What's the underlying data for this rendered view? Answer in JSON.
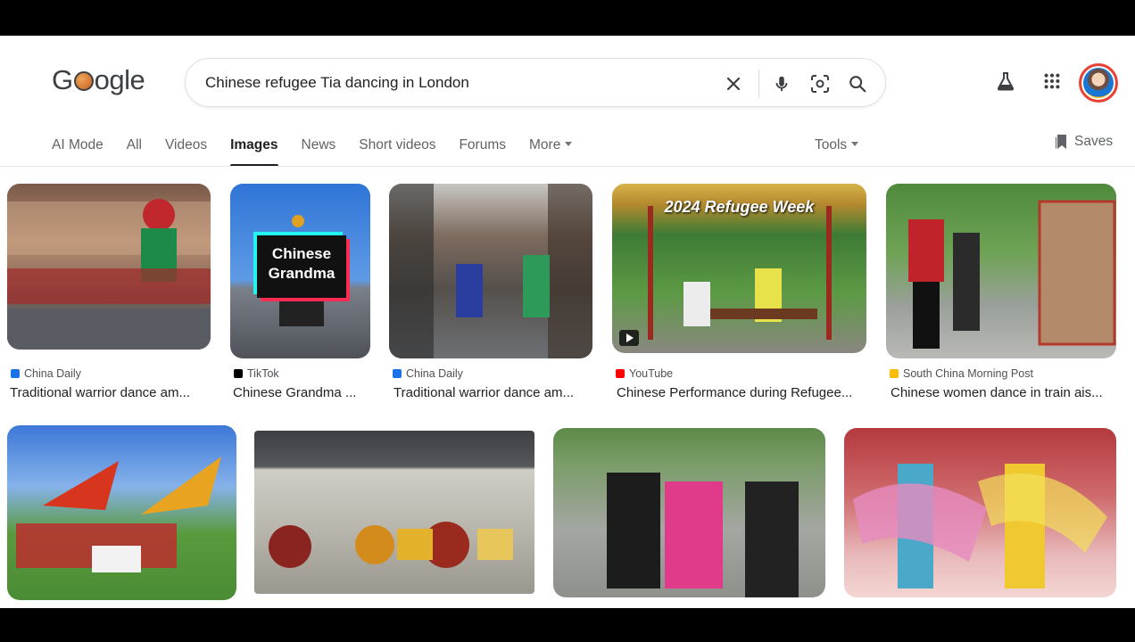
{
  "header": {
    "logo_text": "Google",
    "search_query": "Chinese refugee Tia dancing in London"
  },
  "tabs": [
    {
      "label": "AI Mode"
    },
    {
      "label": "All"
    },
    {
      "label": "Videos"
    },
    {
      "label": "Images",
      "active": true
    },
    {
      "label": "News"
    },
    {
      "label": "Short videos"
    },
    {
      "label": "Forums"
    },
    {
      "label": "More"
    }
  ],
  "tools_label": "Tools",
  "saves_label": "Saves",
  "results_row1": [
    {
      "source": "China Daily",
      "source_color": "#1a73e8",
      "title": "Traditional warrior dance am..."
    },
    {
      "source": "TikTok",
      "source_color": "#000000",
      "title": "Chinese Grandma ...",
      "overlay": "Chinese Grandma"
    },
    {
      "source": "China Daily",
      "source_color": "#1a73e8",
      "title": "Traditional warrior dance am..."
    },
    {
      "source": "YouTube",
      "source_color": "#ff0000",
      "title": "Chinese Performance during Refugee...",
      "overlay": "2024 Refugee Week"
    },
    {
      "source": "South China Morning Post",
      "source_color": "#fbbc04",
      "title": "Chinese women dance in train ais..."
    }
  ],
  "results_row2": [
    {
      "alt": "Dragon flags group photo"
    },
    {
      "alt": "Lion dance drums group"
    },
    {
      "alt": "Women dancing outdoors"
    },
    {
      "alt": "Traditional dancers in costume"
    }
  ],
  "icons": {
    "clear": "close-icon",
    "voice": "mic-icon",
    "lens": "lens-icon",
    "search": "search-icon",
    "labs": "flask-icon",
    "apps": "apps-grid-icon",
    "saves": "bookmark-icon"
  },
  "colors": {
    "accent": "#202124",
    "tab_text": "#5f6368",
    "border": "#dfe1e5"
  }
}
